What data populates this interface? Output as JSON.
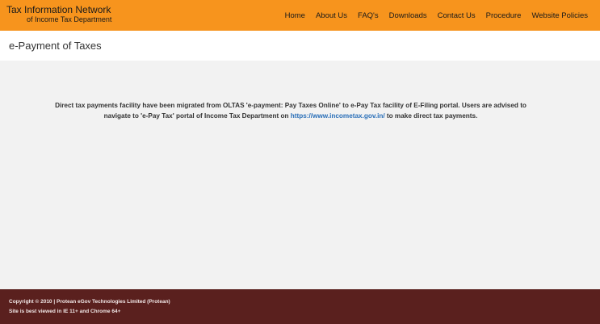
{
  "header": {
    "brand_title": "Tax Information Network",
    "brand_subtitle": "of Income Tax Department",
    "background_color": "#f7941d",
    "nav": [
      {
        "label": "Home"
      },
      {
        "label": "About Us"
      },
      {
        "label": "FAQ's"
      },
      {
        "label": "Downloads"
      },
      {
        "label": "Contact Us"
      },
      {
        "label": "Procedure"
      },
      {
        "label": "Website Policies"
      }
    ]
  },
  "page": {
    "title": "e-Payment of Taxes"
  },
  "notice": {
    "text_before_link": "Direct tax payments facility have been migrated from OLTAS 'e-payment: Pay Taxes Online' to e-Pay Tax facility of E-Filing portal. Users are advised to navigate to 'e-Pay Tax' portal of Income Tax Department on ",
    "link_text": "https://www.incometax.gov.in/",
    "text_after_link": " to make direct tax payments.",
    "link_color": "#2a6fb8"
  },
  "footer": {
    "copyright": "Copyright © 2010 | Protean eGov Technologies Limited (Protean)",
    "browser_note": "Site is best viewed in IE 11+ and Chrome 64+",
    "background_color": "#5a201e"
  }
}
